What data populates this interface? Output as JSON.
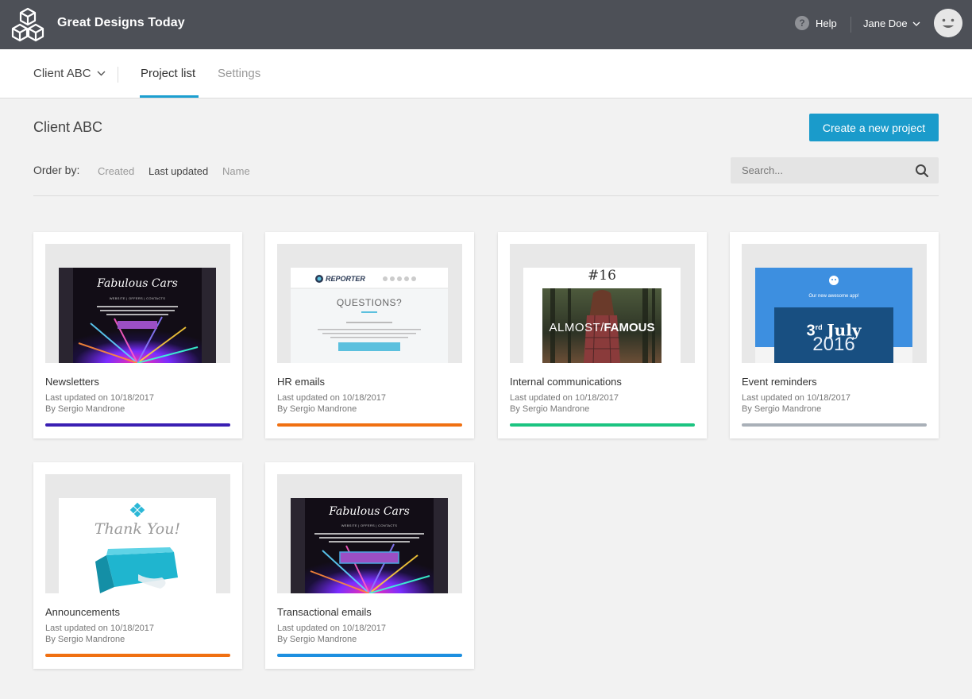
{
  "header": {
    "app_title": "Great Designs Today",
    "help_label": "Help",
    "user_name": "Jane Doe"
  },
  "subnav": {
    "client": "Client ABC",
    "tabs": [
      {
        "label": "Project list",
        "active": true
      },
      {
        "label": "Settings",
        "active": false
      }
    ]
  },
  "main": {
    "title": "Client ABC",
    "create_label": "Create a new project",
    "order_label": "Order by:",
    "order_options": [
      "Created",
      "Last updated",
      "Name"
    ],
    "order_active": "Last updated",
    "search_placeholder": "Search..."
  },
  "preview_text": {
    "fabulous": "Fabulous Cars",
    "nav": "WEBSITE | OFFERS | CONTACTS",
    "reporter": "REPORTER",
    "questions": "QUESTIONS?",
    "issue": "#16",
    "almost": "ALMOST",
    "famous": "FAMOUS",
    "app": "Our new awesome app!",
    "date_day": "3",
    "date_sup": "rd",
    "date_month": "July",
    "date_year": "2016",
    "thanks": "Thank You!"
  },
  "projects": [
    {
      "title": "Newsletters",
      "updated": "Last updated on 10/18/2017",
      "author": "By Sergio Mandrone",
      "color": "#3a1fb3",
      "preview": "fabulous-cars"
    },
    {
      "title": "HR emails",
      "updated": "Last updated on 10/18/2017",
      "author": "By Sergio Mandrone",
      "color": "#f07012",
      "preview": "reporter"
    },
    {
      "title": "Internal communications",
      "updated": "Last updated on 10/18/2017",
      "author": "By Sergio Mandrone",
      "color": "#1cc481",
      "preview": "almost-famous"
    },
    {
      "title": "Event reminders",
      "updated": "Last updated on 10/18/2017",
      "author": "By Sergio Mandrone",
      "color": "#a9b0b8",
      "preview": "event-date"
    },
    {
      "title": "Announcements",
      "updated": "Last updated on 10/18/2017",
      "author": "By Sergio Mandrone",
      "color": "#f07012",
      "preview": "thank-you"
    },
    {
      "title": "Transactional emails",
      "updated": "Last updated on 10/18/2017",
      "author": "By Sergio Mandrone",
      "color": "#1d8fe0",
      "preview": "fabulous-cars"
    }
  ]
}
